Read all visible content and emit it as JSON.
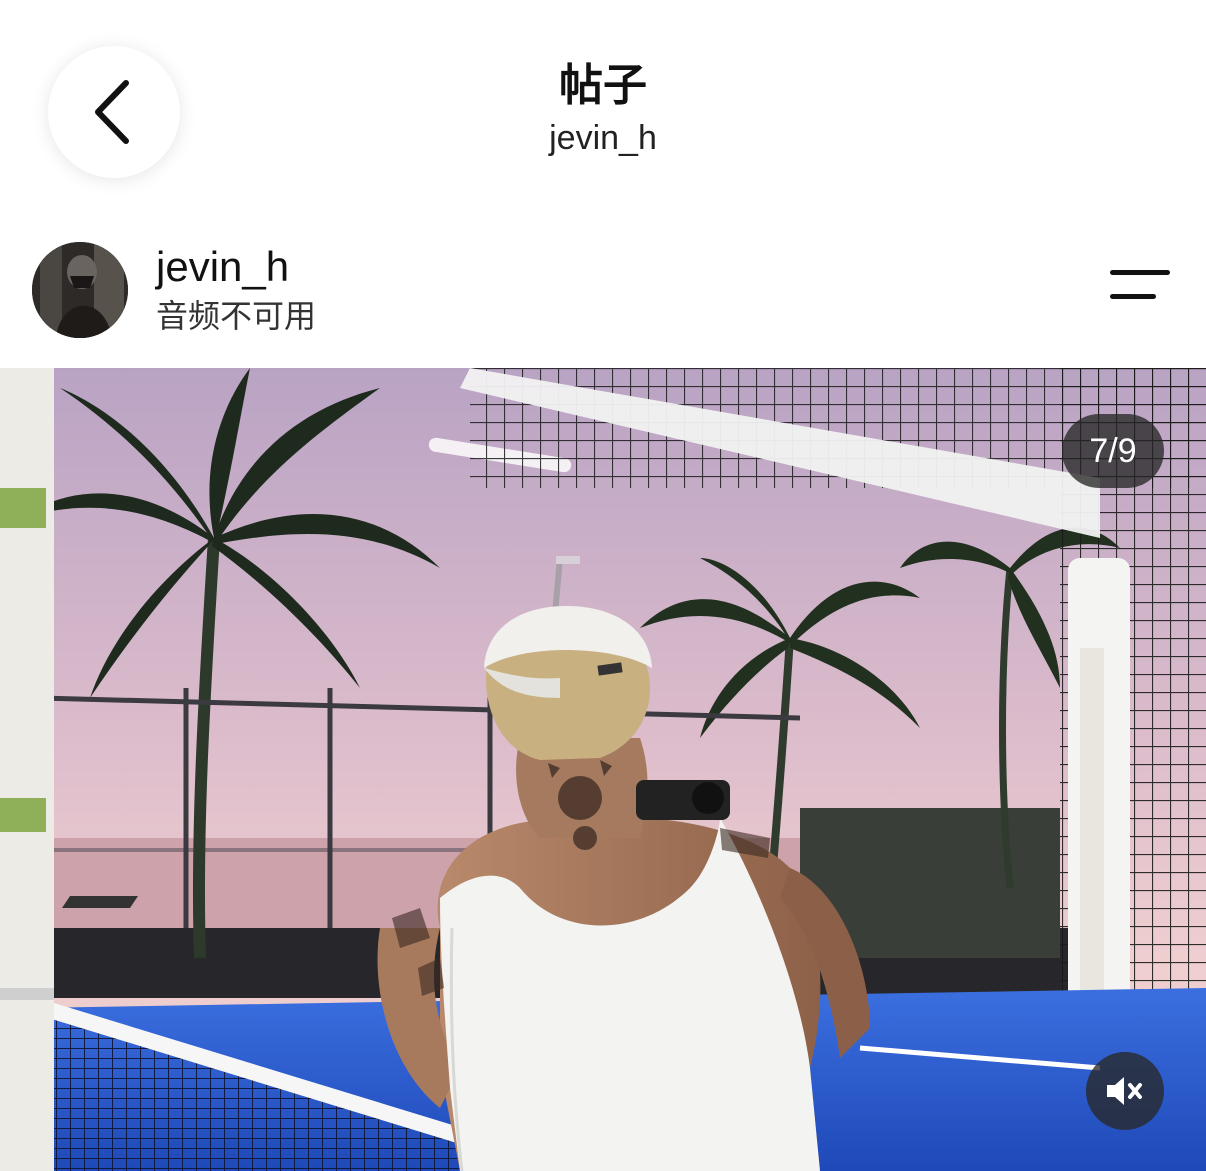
{
  "header": {
    "title": "帖子",
    "subtitle": "jevin_h",
    "back_icon": "chevron-left-icon"
  },
  "post": {
    "username": "jevin_h",
    "audio_note": "音频不可用",
    "menu_icon": "menu-lines-icon",
    "carousel_counter": "7/9",
    "mute_icon": "speaker-muted-icon"
  },
  "colors": {
    "background": "#ffffff",
    "text": "#111111",
    "overlay": "#282828",
    "court_blue": "#2f5fd0",
    "sky_pink": "#d9b7c6"
  }
}
